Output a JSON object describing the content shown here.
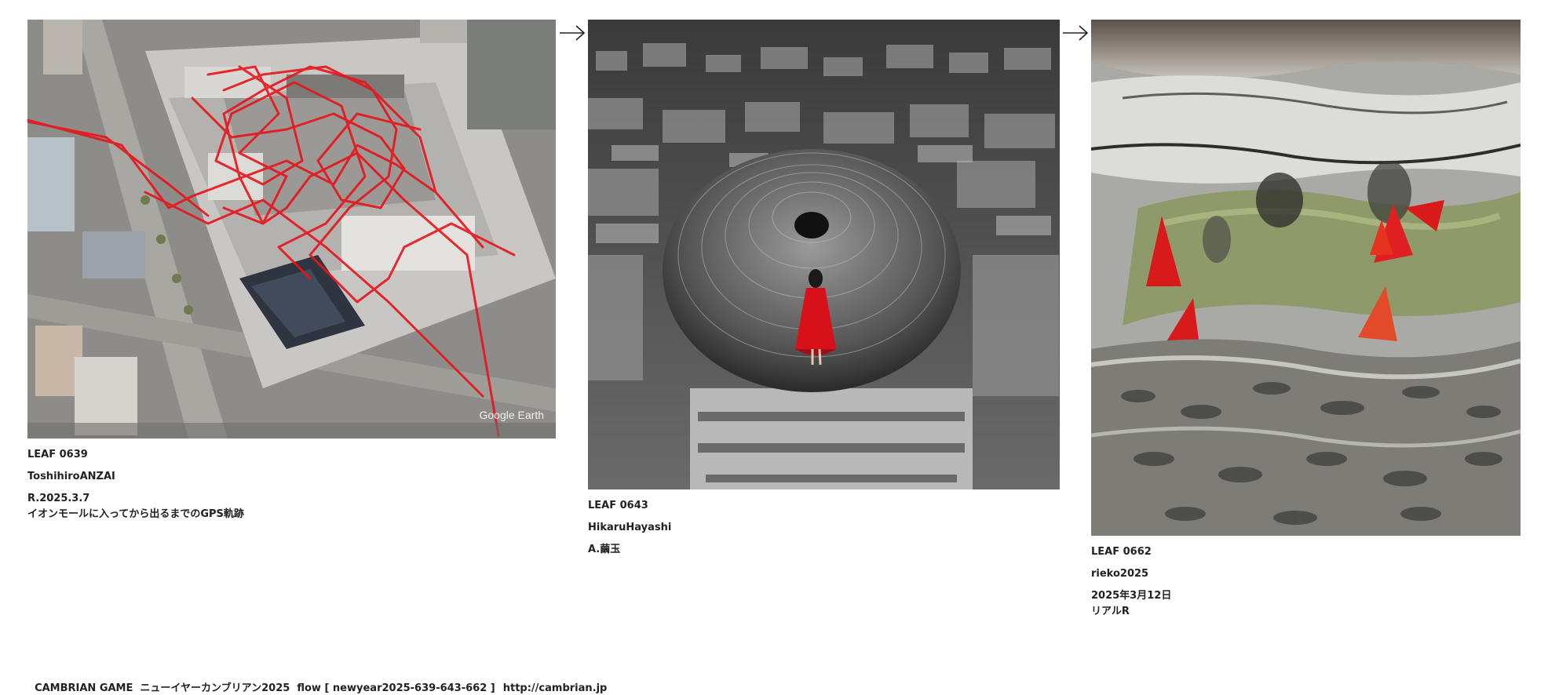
{
  "leaves": [
    {
      "id": "LEAF 0639",
      "author": "ToshihiroANZAI",
      "title": "R.2025.3.7",
      "description": "イオンモールに入ってから出るまでのGPS軌跡",
      "image_overlay": "Google Earth"
    },
    {
      "id": "LEAF 0643",
      "author": "HikaruHayashi",
      "title": "A.繭玉"
    },
    {
      "id": "LEAF 0662",
      "author": "rieko2025",
      "title": "2025年3月12日",
      "description": "リアルR"
    }
  ],
  "footer": {
    "text": "CAMBRIAN GAME  ニューイヤーカンブリアン2025  flow [ newyear2025-639-643-662 ]",
    "url": "http://cambrian.jp"
  },
  "colors": {
    "caption_text": "#222222",
    "gps_track": "#e8141c",
    "background": "#ffffff"
  },
  "icons": [
    "right-arrow-icon"
  ]
}
